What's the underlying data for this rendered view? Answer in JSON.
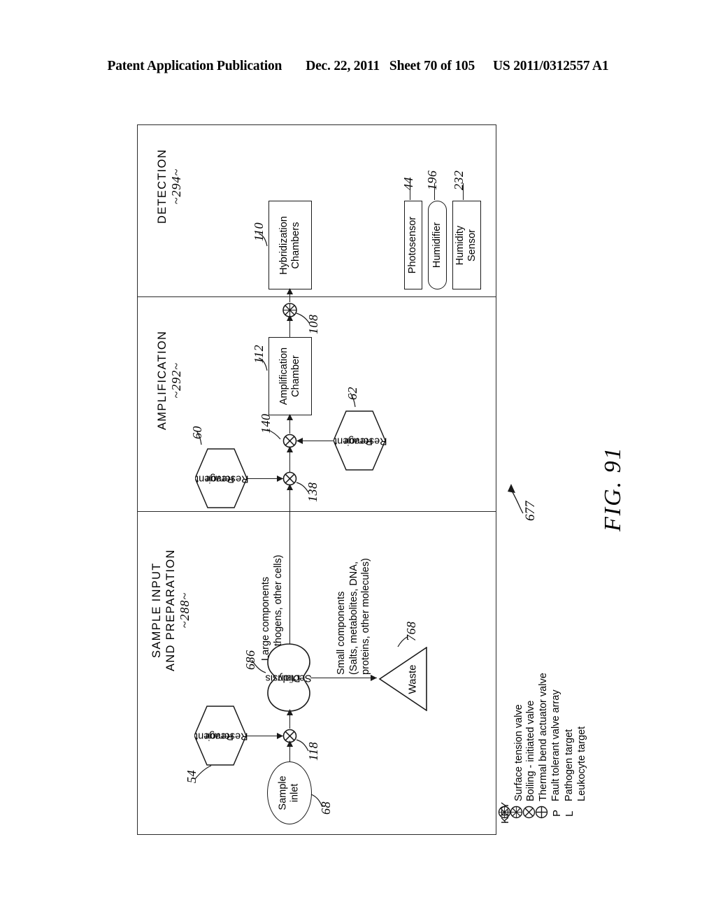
{
  "header": {
    "publication": "Patent Application Publication",
    "date": "Dec. 22, 2011",
    "sheet": "Sheet 70 of 105",
    "patent_number": "US 2011/0312557 A1"
  },
  "figure": {
    "label": "FIG. 91",
    "reference": "677"
  },
  "sections": [
    {
      "name": "detection",
      "title": "DETECTION",
      "number": "~294~"
    },
    {
      "name": "amplification",
      "title": "AMPLIFICATION",
      "number": "~292~"
    },
    {
      "name": "sample_input",
      "title_line1": "SAMPLE INPUT",
      "title_line2": "AND PREPARATION",
      "number": "~288~"
    }
  ],
  "nodes": {
    "hybridization_chambers": {
      "line1": "Hybridization",
      "line2": "Chambers",
      "ref": "110"
    },
    "amplification_chamber": {
      "line1": "Amplification",
      "line2": "Chamber",
      "ref": "112"
    },
    "photosensor": {
      "label": "Photosensor",
      "ref": "44"
    },
    "humidifier": {
      "label": "Humidifier",
      "ref": "196"
    },
    "humidity_sensor": {
      "line1": "Humidity",
      "line2": "Sensor",
      "ref": "232"
    },
    "reagent_reservoir_60": {
      "line1": "Reagent",
      "line2": "Reservoir",
      "ref": "60"
    },
    "reagent_reservoir_62": {
      "line1": "Reagent",
      "line2": "Reservoir",
      "ref": "62"
    },
    "reagent_reservoir_54": {
      "line1": "Reagent",
      "line2": "Reservoir",
      "ref": "54"
    },
    "dialysis_section": {
      "line1": "Dialysis",
      "line2": "Section",
      "ref": "686"
    },
    "waste": {
      "label": "Waste",
      "ref": "768"
    },
    "sample_inlet": {
      "line1": "Sample",
      "line2": "inlet",
      "ref": "68"
    }
  },
  "valves": [
    {
      "name": "valve-108",
      "ref": "108",
      "style": "hatched"
    },
    {
      "name": "valve-140",
      "ref": "140",
      "style": "plain"
    },
    {
      "name": "valve-138",
      "ref": "138",
      "style": "plain"
    },
    {
      "name": "valve-118",
      "ref": "118",
      "style": "plain"
    }
  ],
  "flow_annotations": {
    "large_components": {
      "line1": "Large components",
      "line2": "(pathogens, other cells)"
    },
    "small_components": {
      "line1": "Small components",
      "line2": "(Salts, metabolites, DNA,",
      "line3": "proteins, other molecules)"
    }
  },
  "key": {
    "title": "KEY",
    "entries": [
      {
        "symbol": "hatched-circle-x",
        "char": "",
        "text": "Surface tension valve"
      },
      {
        "symbol": "hatched-circle-x",
        "char": "",
        "text": "Boiling - initiated valve"
      },
      {
        "symbol": "circle-x",
        "char": "",
        "text": "Thermal bend actuator valve"
      },
      {
        "symbol": "circle-plus",
        "char": "",
        "text": "Fault tolerant valve array"
      },
      {
        "symbol": "letter",
        "char": "P",
        "text": "Pathogen target"
      },
      {
        "symbol": "letter",
        "char": "L",
        "text": "Leukocyte target"
      }
    ]
  },
  "colors": {
    "line": "#1a1a1a",
    "frame": "#2b2b2b",
    "background": "#ffffff"
  }
}
